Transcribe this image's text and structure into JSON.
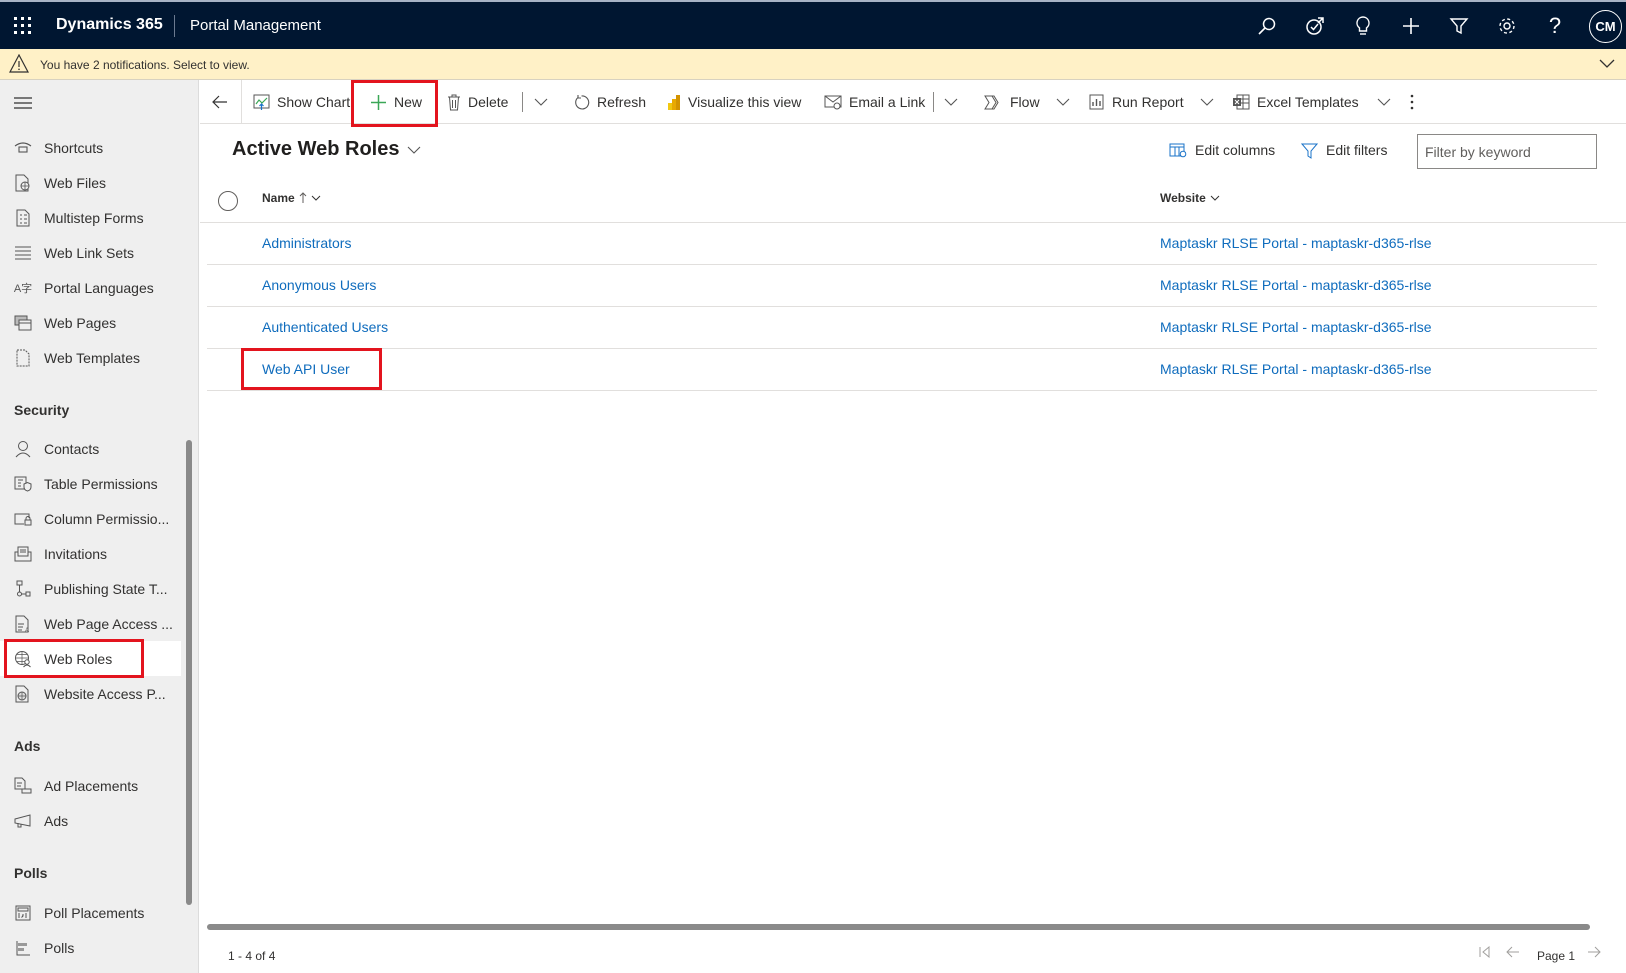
{
  "topbar": {
    "brand": "Dynamics 365",
    "app_name": "Portal Management",
    "icons": [
      "search-icon",
      "task-icon",
      "lightbulb-icon",
      "plus-icon",
      "filter-icon",
      "gear-icon",
      "help-icon"
    ],
    "avatar_initials": "CM"
  },
  "notification": {
    "text": "You have 2 notifications. Select to view."
  },
  "sidebar": {
    "groups": [
      {
        "items": [
          {
            "label": "Shortcuts",
            "icon": "shortcuts-icon"
          },
          {
            "label": "Web Files",
            "icon": "web-file-icon"
          },
          {
            "label": "Multistep Forms",
            "icon": "form-icon"
          },
          {
            "label": "Web Link Sets",
            "icon": "list-icon"
          },
          {
            "label": "Portal Languages",
            "icon": "language-icon"
          },
          {
            "label": "Web Pages",
            "icon": "web-pages-icon"
          },
          {
            "label": "Web Templates",
            "icon": "template-icon"
          }
        ]
      },
      {
        "title": "Security",
        "items": [
          {
            "label": "Contacts",
            "icon": "person-icon"
          },
          {
            "label": "Table Permissions",
            "icon": "table-shield-icon"
          },
          {
            "label": "Column Permissio...",
            "icon": "column-lock-icon"
          },
          {
            "label": "Invitations",
            "icon": "invitation-icon"
          },
          {
            "label": "Publishing State T...",
            "icon": "flow-state-icon"
          },
          {
            "label": "Web Page Access ...",
            "icon": "page-access-icon"
          },
          {
            "label": "Web Roles",
            "icon": "web-roles-icon",
            "selected": true
          },
          {
            "label": "Website Access P...",
            "icon": "website-access-icon"
          }
        ]
      },
      {
        "title": "Ads",
        "items": [
          {
            "label": "Ad Placements",
            "icon": "ad-placement-icon"
          },
          {
            "label": "Ads",
            "icon": "megaphone-icon"
          }
        ]
      },
      {
        "title": "Polls",
        "items": [
          {
            "label": "Poll Placements",
            "icon": "poll-placement-icon"
          },
          {
            "label": "Polls",
            "icon": "poll-icon"
          }
        ]
      }
    ]
  },
  "toolbar": {
    "show_chart": "Show Chart",
    "new": "New",
    "delete": "Delete",
    "refresh": "Refresh",
    "visualize": "Visualize this view",
    "email_link": "Email a Link",
    "flow": "Flow",
    "run_report": "Run Report",
    "excel_templates": "Excel Templates"
  },
  "view": {
    "title": "Active Web Roles",
    "edit_columns": "Edit columns",
    "edit_filters": "Edit filters",
    "filter_placeholder": "Filter by keyword",
    "columns": [
      {
        "label": "Name",
        "sort": "ascending"
      },
      {
        "label": "Website"
      }
    ],
    "rows": [
      {
        "name": "Administrators",
        "website": "Maptaskr RLSE Portal - maptaskr-d365-rlse"
      },
      {
        "name": "Anonymous Users",
        "website": "Maptaskr RLSE Portal - maptaskr-d365-rlse"
      },
      {
        "name": "Authenticated Users",
        "website": "Maptaskr RLSE Portal - maptaskr-d365-rlse"
      },
      {
        "name": "Web API User",
        "website": "Maptaskr RLSE Portal - maptaskr-d365-rlse"
      }
    ],
    "record_count": "1 - 4 of 4",
    "page_label": "Page 1"
  },
  "colors": {
    "topbar_bg": "#001631",
    "notification_bg": "#fff1c7",
    "link": "#0f6cbd",
    "highlight_box": "#e3141e",
    "new_plus": "#3aa757"
  }
}
